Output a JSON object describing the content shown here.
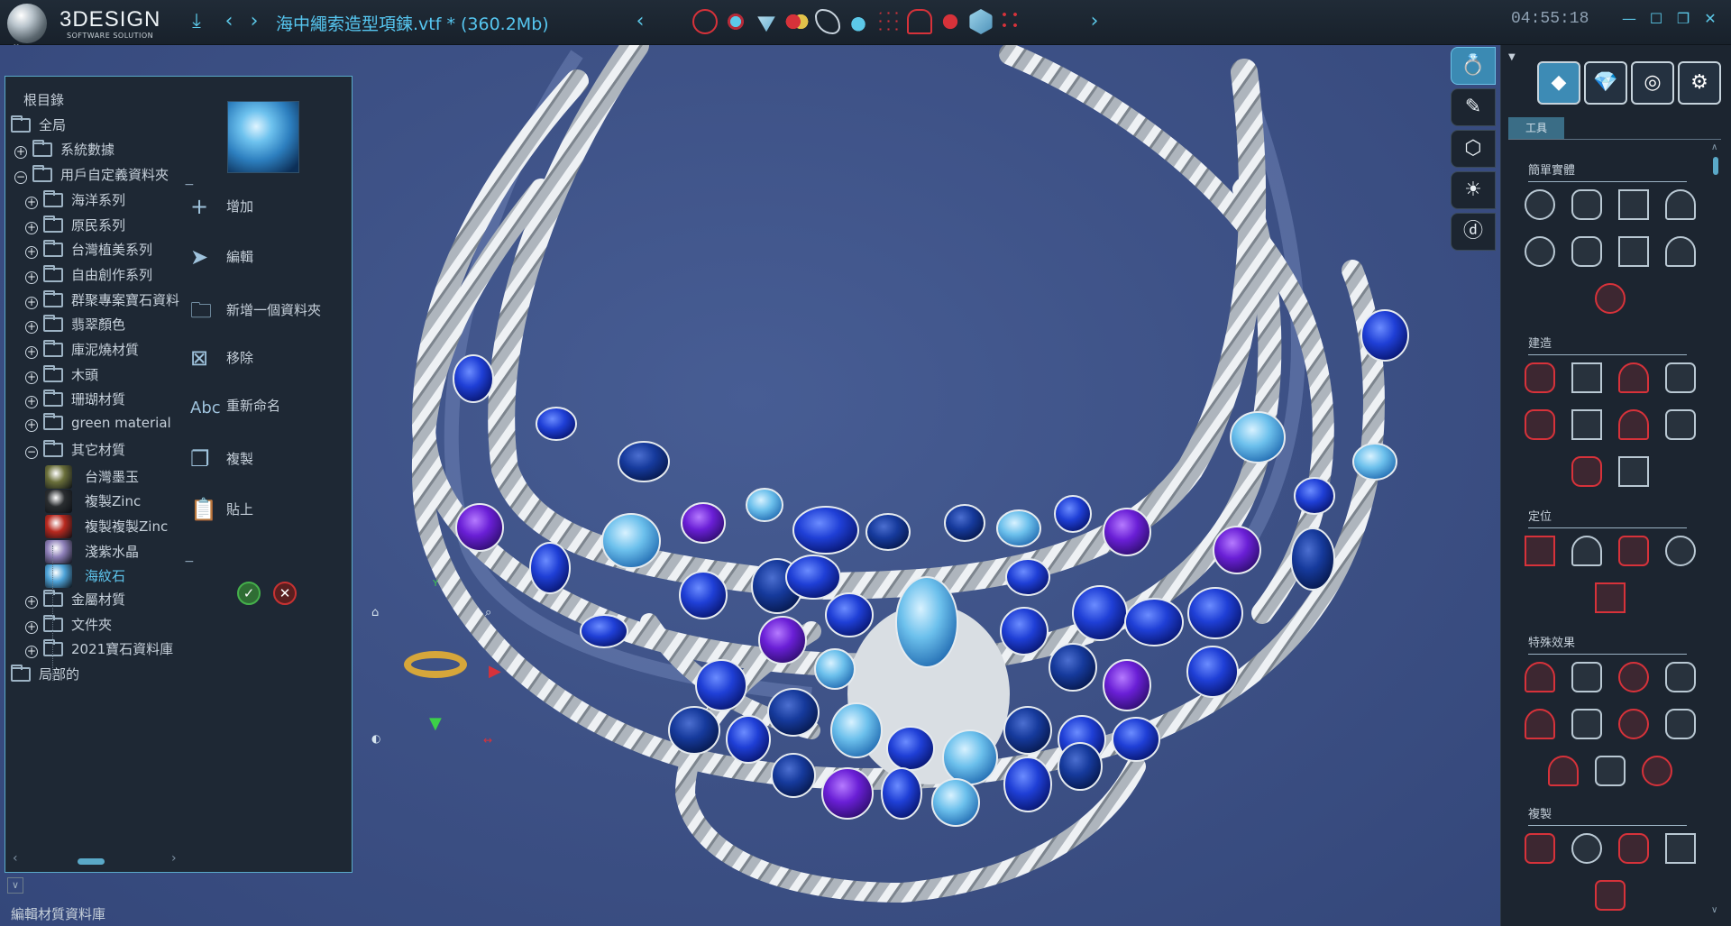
{
  "app": {
    "logo_title": "3DESIGN",
    "logo_subtitle": "SOFTWARE SOLUTION",
    "document_title": "海中繩索造型項鍊.vtf *  (360.2Mb)",
    "clock": "04:55:18"
  },
  "library": {
    "tree": [
      {
        "label": "根目錄",
        "level": 0,
        "type": "root"
      },
      {
        "label": "全局",
        "level": 0,
        "type": "folder"
      },
      {
        "label": "系統數據",
        "level": 1,
        "type": "folder",
        "expander": "+"
      },
      {
        "label": "用戶自定義資料夾",
        "level": 1,
        "type": "folder",
        "expander": "−"
      },
      {
        "label": "海洋系列",
        "level": 2,
        "type": "folder",
        "expander": "+"
      },
      {
        "label": "原民系列",
        "level": 2,
        "type": "folder",
        "expander": "+"
      },
      {
        "label": "台灣植美系列",
        "level": 2,
        "type": "folder",
        "expander": "+"
      },
      {
        "label": "自由創作系列",
        "level": 2,
        "type": "folder",
        "expander": "+"
      },
      {
        "label": "群聚專案寶石資料",
        "level": 2,
        "type": "folder",
        "expander": "+"
      },
      {
        "label": "翡翠顏色",
        "level": 2,
        "type": "folder",
        "expander": "+"
      },
      {
        "label": "庫泥燒材質",
        "level": 2,
        "type": "folder",
        "expander": "+"
      },
      {
        "label": "木頭",
        "level": 2,
        "type": "folder",
        "expander": "+"
      },
      {
        "label": "珊瑚材質",
        "level": 2,
        "type": "folder",
        "expander": "+"
      },
      {
        "label": "green material",
        "level": 2,
        "type": "folder",
        "expander": "+"
      },
      {
        "label": "其它材質",
        "level": 2,
        "type": "folder",
        "expander": "−"
      },
      {
        "label": "台灣墨玉",
        "level": 3,
        "type": "material",
        "color": "#6a6f3a"
      },
      {
        "label": "複製Zinc",
        "level": 3,
        "type": "material",
        "color": "#2a2d30"
      },
      {
        "label": "複製複製Zinc",
        "level": 3,
        "type": "material",
        "color": "#b8291f"
      },
      {
        "label": "淺紫水晶",
        "level": 3,
        "type": "material",
        "color": "#8d7fb8"
      },
      {
        "label": "海紋石",
        "level": 3,
        "type": "material",
        "color": "#4ea3d8",
        "selected": true
      },
      {
        "label": "金屬材質",
        "level": 2,
        "type": "folder",
        "expander": "+"
      },
      {
        "label": "文件夾",
        "level": 2,
        "type": "folder",
        "expander": "+"
      },
      {
        "label": "2021寶石資料庫",
        "level": 2,
        "type": "folder",
        "expander": "+"
      },
      {
        "label": "局部的",
        "level": 0,
        "type": "folder"
      }
    ],
    "actions": [
      {
        "label": "增加",
        "icon": "plus-icon"
      },
      {
        "label": "編輯",
        "icon": "cursor-arrow-icon"
      },
      {
        "label": "新增一個資料夾",
        "icon": "new-folder-icon"
      },
      {
        "label": "移除",
        "icon": "delete-icon"
      },
      {
        "label": "重新命名",
        "icon": "rename-icon"
      },
      {
        "label": "複製",
        "icon": "copy-icon"
      },
      {
        "label": "貼上",
        "icon": "paste-icon"
      }
    ],
    "ok_symbol": "✓",
    "cancel_symbol": "✕"
  },
  "status": {
    "text": "編輯材質資料庫"
  },
  "tool_panel": {
    "tab": "工具",
    "sections": [
      {
        "title": "簡單實體"
      },
      {
        "title": "建造"
      },
      {
        "title": "定位"
      },
      {
        "title": "特殊效果"
      },
      {
        "title": "複製"
      }
    ]
  },
  "colors": {
    "accent": "#5cc8e8",
    "panel_bg": "#1e2834",
    "viewport_bg": "#3e5287"
  }
}
